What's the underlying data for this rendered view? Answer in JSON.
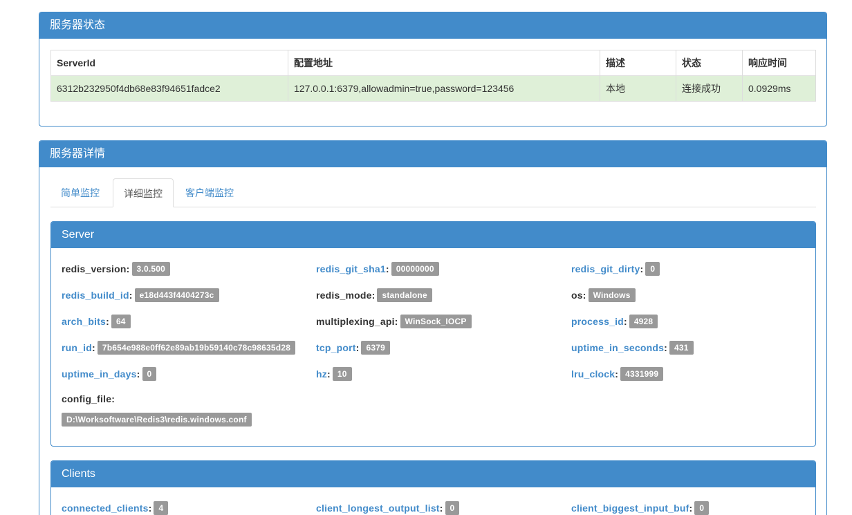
{
  "status_panel": {
    "title": "服务器状态",
    "headers": [
      "ServerId",
      "配置地址",
      "描述",
      "状态",
      "响应时间"
    ],
    "row": [
      "6312b232950f4db68e83f94651fadce2",
      "127.0.0.1:6379,allowadmin=true,password=123456",
      "本地",
      "连接成功",
      "0.0929ms"
    ]
  },
  "detail_panel": {
    "title": "服务器详情",
    "tabs": [
      "简单监控",
      "详细监控",
      "客户端监控"
    ]
  },
  "server": {
    "title": "Server",
    "items": [
      {
        "key": "redis_version",
        "sep": " : ",
        "value": "3.0.500"
      },
      {
        "key": "redis_git_sha1",
        "sep": ": ",
        "value": "00000000"
      },
      {
        "key": "redis_git_dirty",
        "sep": ": ",
        "value": "0"
      },
      {
        "key": "redis_build_id",
        "sep": ": ",
        "value": "e18d443f4404273c"
      },
      {
        "key": "redis_mode",
        "sep": " : ",
        "value": "standalone"
      },
      {
        "key": "os",
        "sep": " : ",
        "value": "Windows"
      },
      {
        "key": "arch_bits",
        "sep": ": ",
        "value": "64"
      },
      {
        "key": "multiplexing_api",
        "sep": " : ",
        "value": "WinSock_IOCP"
      },
      {
        "key": "process_id",
        "sep": ": ",
        "value": "4928"
      },
      {
        "key": "run_id",
        "sep": ": ",
        "value": "7b654e988e0ff62e89ab19b59140c78c98635d28"
      },
      {
        "key": "tcp_port",
        "sep": ": ",
        "value": "6379"
      },
      {
        "key": "uptime_in_seconds",
        "sep": ": ",
        "value": "431"
      },
      {
        "key": "uptime_in_days",
        "sep": ": ",
        "value": "0"
      },
      {
        "key": "hz",
        "sep": ": ",
        "value": "10"
      },
      {
        "key": "lru_clock",
        "sep": ": ",
        "value": "4331999"
      },
      {
        "key": "config_file",
        "sep": " :",
        "value": "D:\\Worksoftware\\Redis3\\redis.windows.conf"
      }
    ]
  },
  "clients": {
    "title": "Clients",
    "items": [
      {
        "key": "connected_clients",
        "sep": ": ",
        "value": "4"
      },
      {
        "key": "client_longest_output_list",
        "sep": ": ",
        "value": "0"
      },
      {
        "key": "client_biggest_input_buf",
        "sep": ": ",
        "value": "0"
      }
    ]
  }
}
